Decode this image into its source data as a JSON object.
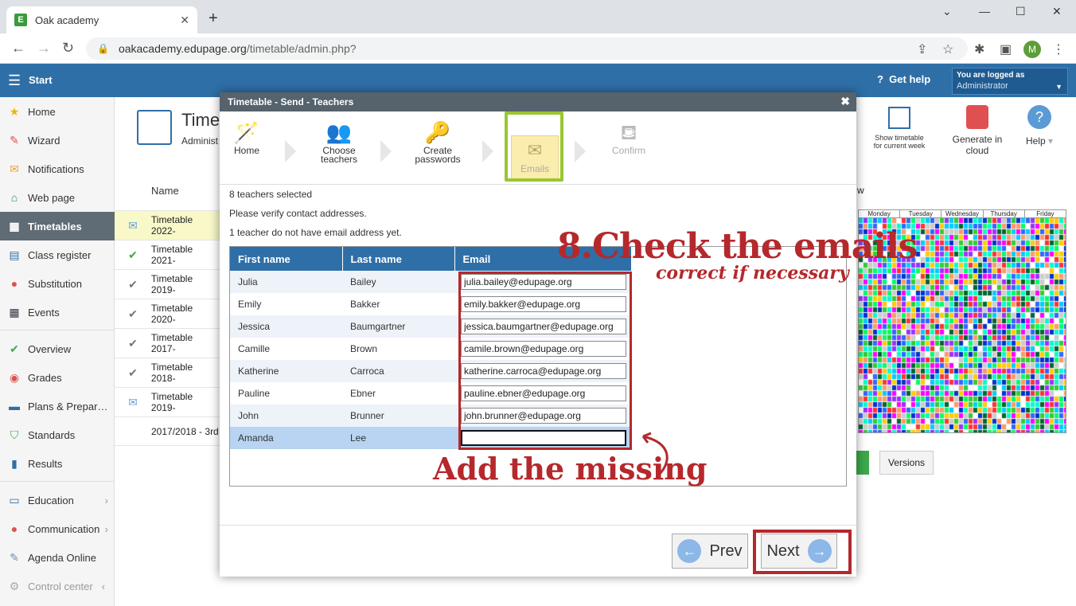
{
  "browser": {
    "tab_title": "Oak academy",
    "tab_favicon": "E",
    "url_host": "oakacademy.edupage.org",
    "url_path": "/timetable/admin.php?",
    "profile_initial": "M"
  },
  "appbar": {
    "start_label": "Start",
    "help_label": "Get help",
    "logged_label": "You are logged as",
    "logged_user": "Administrator"
  },
  "sidebar": {
    "items": [
      {
        "label": "Home",
        "icon": "star-icon"
      },
      {
        "label": "Wizard",
        "icon": "wand-icon"
      },
      {
        "label": "Notifications",
        "icon": "envelope-icon"
      },
      {
        "label": "Web page",
        "icon": "house-icon"
      },
      {
        "label": "Timetables",
        "icon": "grid-icon"
      },
      {
        "label": "Class register",
        "icon": "book-icon"
      },
      {
        "label": "Substitution",
        "icon": "person-icon"
      },
      {
        "label": "Events",
        "icon": "calendar-icon"
      },
      {
        "label": "Overview",
        "icon": "check-circle-icon"
      },
      {
        "label": "Grades",
        "icon": "grades-icon"
      },
      {
        "label": "Plans & Prepar…",
        "icon": "briefcase-icon"
      },
      {
        "label": "Standards",
        "icon": "shield-icon"
      },
      {
        "label": "Results",
        "icon": "bar-chart-icon"
      },
      {
        "label": "Education",
        "icon": "open-book-icon"
      },
      {
        "label": "Communication",
        "icon": "chat-icon"
      },
      {
        "label": "Agenda Online",
        "icon": "pencil-icon"
      },
      {
        "label": "Control center",
        "icon": "gear-icon"
      }
    ]
  },
  "background": {
    "title": "Timet",
    "subtitle": "Administ",
    "name_header": "Name",
    "rows": [
      "Timetable 2022-",
      "Timetable 2021-",
      "Timetable 2019-",
      "Timetable 2020-",
      "Timetable 2017-",
      "Timetable 2018-",
      "Timetable 2019-",
      "2017/2018 - 3rd"
    ],
    "tools": {
      "show_timetable": "Show timetable for current week",
      "generate": "Generate in cloud",
      "help": "Help"
    },
    "days": [
      "Monday",
      "Tuesday",
      "Wednesday",
      "Thursday",
      "Friday"
    ],
    "versions_label": "Versions",
    "partial_w": "w"
  },
  "modal": {
    "title": "Timetable - Send - Teachers",
    "steps": [
      {
        "label": "Home"
      },
      {
        "label": "Choose teachers"
      },
      {
        "label": "Create passwords"
      },
      {
        "label": "Emails"
      },
      {
        "label": "Confirm"
      }
    ],
    "info_selected": "8 teachers selected",
    "info_verify": "Please verify contact addresses.",
    "info_missing": "1 teacher do not have email address yet.",
    "columns": [
      "First name",
      "Last name",
      "Email"
    ],
    "teachers": [
      {
        "first": "Julia",
        "last": "Bailey",
        "email": "julia.bailey@edupage.org"
      },
      {
        "first": "Emily",
        "last": "Bakker",
        "email": "emily.bakker@edupage.org"
      },
      {
        "first": "Jessica",
        "last": "Baumgartner",
        "email": "jessica.baumgartner@edupage.org"
      },
      {
        "first": "Camille",
        "last": "Brown",
        "email": "camile.brown@edupage.org"
      },
      {
        "first": "Katherine",
        "last": "Carroca",
        "email": "katherine.carroca@edupage.org"
      },
      {
        "first": "Pauline",
        "last": "Ebner",
        "email": "pauline.ebner@edupage.org"
      },
      {
        "first": "John",
        "last": "Brunner",
        "email": "john.brunner@edupage.org"
      },
      {
        "first": "Amanda",
        "last": "Lee",
        "email": ""
      }
    ],
    "prev_label": "Prev",
    "next_label": "Next"
  },
  "annotations": {
    "step_number": "8.",
    "headline": "Check the emails",
    "sub": "correct if necessary",
    "missing": "Add the missing"
  },
  "colors": {
    "appbar": "#2f6fa7",
    "annotation": "#b5282c",
    "step_highlight": "#9ac632"
  }
}
